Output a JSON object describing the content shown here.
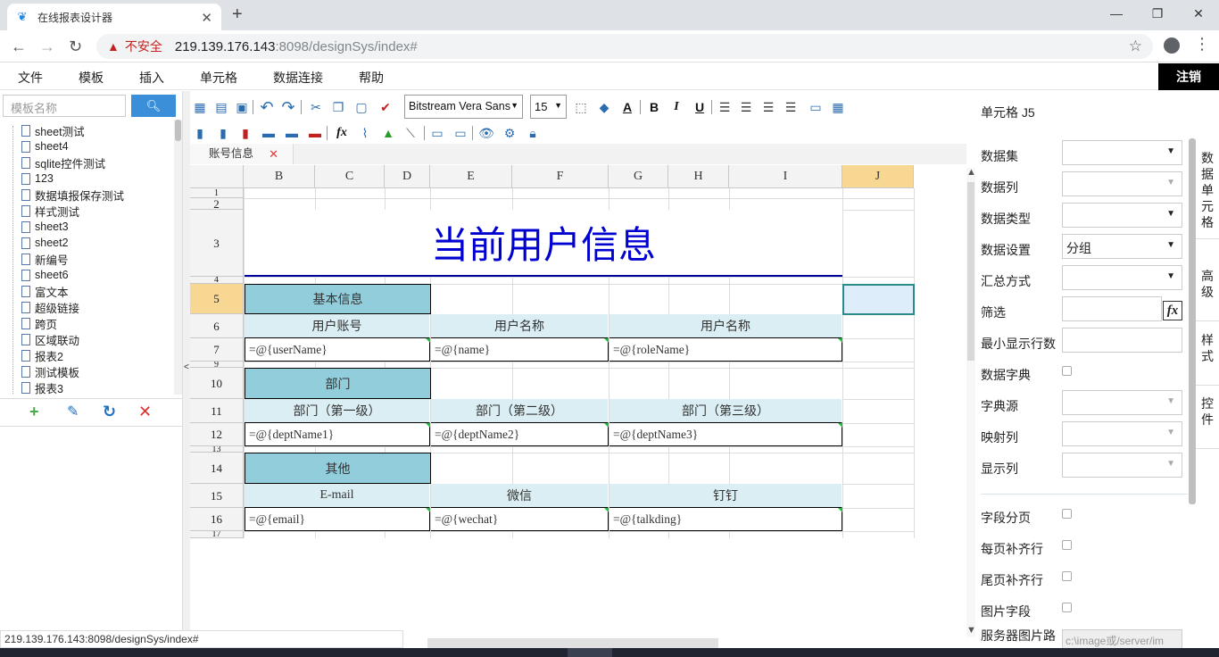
{
  "browser": {
    "tab_title": "在线报表设计器",
    "insecure_label": "不安全",
    "url_host": "219.139.176.143",
    "url_rest": ":8098/designSys/index#",
    "status_url": "219.139.176.143:8098/designSys/index#"
  },
  "menu": {
    "items": [
      "文件",
      "模板",
      "插入",
      "单元格",
      "数据连接",
      "帮助"
    ],
    "logout": "注销"
  },
  "sidebar": {
    "search_placeholder": "模板名称",
    "items": [
      "sheet测试",
      "sheet4",
      "sqlite控件测试",
      "123",
      "数据填报保存测试",
      "样式测试",
      "sheet3",
      "sheet2",
      "新编号",
      "sheet6",
      "富文本",
      "超级链接",
      "跨页",
      "区域联动",
      "报表2",
      "测试模板",
      "报表3"
    ]
  },
  "toolbar": {
    "font": "Bitstream Vera Sans",
    "size": "15"
  },
  "sheet": {
    "tab": "账号信息",
    "columns": [
      "B",
      "C",
      "D",
      "E",
      "F",
      "G",
      "H",
      "I",
      "J"
    ],
    "rows": [
      "1",
      "2",
      "3",
      "4",
      "5",
      "6",
      "7",
      "9",
      "10",
      "11",
      "12",
      "13",
      "14",
      "15",
      "16",
      "17"
    ],
    "title": "当前用户信息",
    "sec1": "基本信息",
    "h1": [
      "用户账号",
      "用户名称",
      "用户名称"
    ],
    "d1": [
      "=@{userName}",
      "=@{name}",
      "=@{roleName}"
    ],
    "sec2": "部门",
    "h2": [
      "部门（第一级）",
      "部门（第二级）",
      "部门（第三级）"
    ],
    "d2": [
      "=@{deptName1}",
      "=@{deptName2}",
      "=@{deptName3}"
    ],
    "sec3": "其他",
    "h3": [
      "E-mail",
      "微信",
      "钉钉"
    ],
    "d3": [
      "=@{email}",
      "=@{wechat}",
      "=@{talkding}"
    ]
  },
  "panel": {
    "title": "单元格 J5",
    "labels": [
      "数据集",
      "数据列",
      "数据类型",
      "数据设置",
      "汇总方式",
      "筛选",
      "最小显示行数",
      "数据字典",
      "字典源",
      "映射列",
      "显示列",
      "字段分页",
      "每页补齐行",
      "尾页补齐行",
      "图片字段",
      "服务器图片路"
    ],
    "data_setting_value": "分组",
    "fx": "fx",
    "image_path_placeholder": "c:\\image或/server/im",
    "vtabs": [
      "数据单元格",
      "高级",
      "样式",
      "控件"
    ]
  }
}
